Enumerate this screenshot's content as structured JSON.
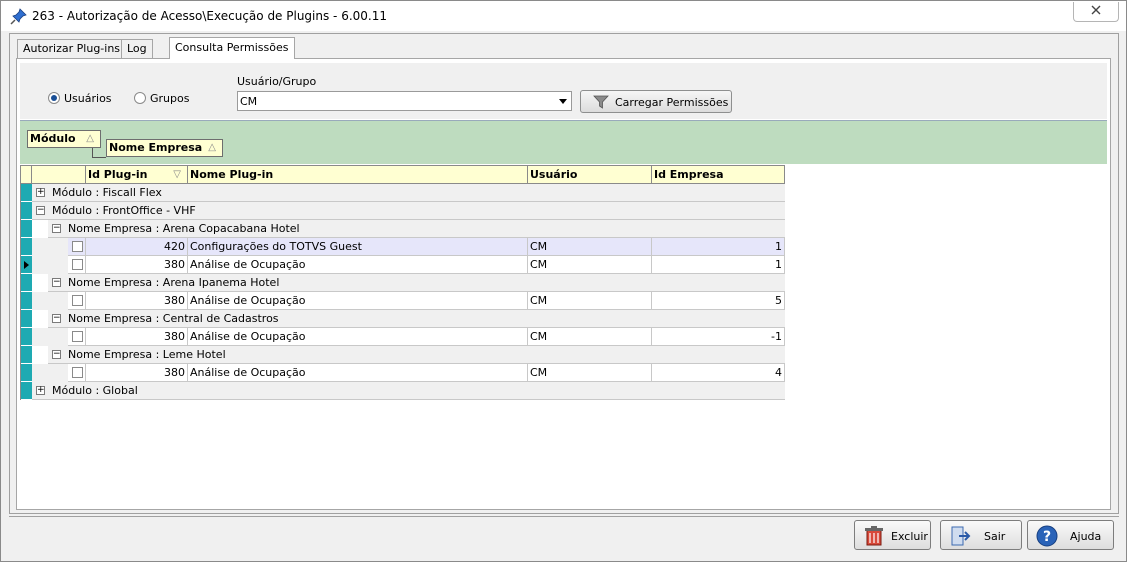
{
  "window": {
    "title": "263 - Autorização de Acesso\\Execução de Plugins - 6.00.11"
  },
  "tabs": [
    {
      "label": "Autorizar Plug-ins"
    },
    {
      "label": "Log"
    },
    {
      "label": "Consulta Permissões"
    }
  ],
  "filter": {
    "radio_users": "Usuários",
    "radio_groups": "Grupos",
    "selected": "Usuários",
    "usergroup_label": "Usuário/Grupo",
    "usergroup_value": "CM",
    "load_button": "Carregar Permissões"
  },
  "grouping": [
    {
      "label": "Módulo"
    },
    {
      "label": "Nome Empresa"
    }
  ],
  "grid": {
    "columns": [
      "Id Plug-in",
      "Nome Plug-in",
      "Usuário",
      "Id Empresa"
    ],
    "rows": [
      {
        "kind": "module",
        "text": "Módulo : Fiscall Flex",
        "expanded": false
      },
      {
        "kind": "module",
        "text": "Módulo : FrontOffice - VHF",
        "expanded": true
      },
      {
        "kind": "company",
        "text": "Nome Empresa : Arena Copacabana Hotel"
      },
      {
        "kind": "data",
        "id": "420",
        "name": "Configurações do TOTVS Guest",
        "user": "CM",
        "company_id": "1",
        "highlight": true
      },
      {
        "kind": "data",
        "id": "380",
        "name": "Análise de Ocupação",
        "user": "CM",
        "company_id": "1",
        "current": true
      },
      {
        "kind": "company",
        "text": "Nome Empresa : Arena Ipanema Hotel"
      },
      {
        "kind": "data",
        "id": "380",
        "name": "Análise de Ocupação",
        "user": "CM",
        "company_id": "5"
      },
      {
        "kind": "company",
        "text": "Nome Empresa : Central de Cadastros"
      },
      {
        "kind": "data",
        "id": "380",
        "name": "Análise de Ocupação",
        "user": "CM",
        "company_id": "-1"
      },
      {
        "kind": "company",
        "text": "Nome Empresa : Leme Hotel"
      },
      {
        "kind": "data",
        "id": "380",
        "name": "Análise de Ocupação",
        "user": "CM",
        "company_id": "4"
      },
      {
        "kind": "module",
        "text": "Módulo : Global",
        "expanded": false
      }
    ]
  },
  "footer": {
    "delete": "Excluir",
    "exit": "Sair",
    "help": "Ajuda"
  },
  "colors": {
    "indicator": "#1eaab2",
    "group_bar": "#bedcbf",
    "header_bg": "#ffffd2",
    "highlight_row": "#e6e6fa"
  }
}
